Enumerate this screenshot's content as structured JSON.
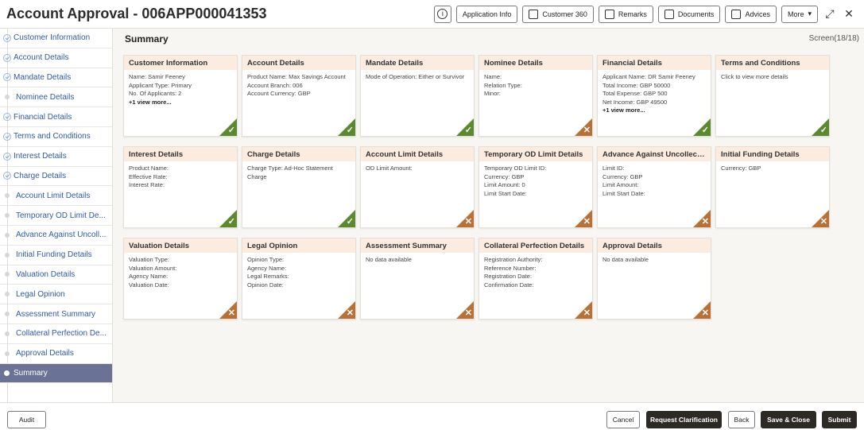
{
  "header": {
    "title": "Account Approval - 006APP000041353",
    "buttons": {
      "info": "i",
      "application_info": "Application Info",
      "customer_360": "Customer 360",
      "remarks": "Remarks",
      "documents": "Documents",
      "advices": "Advices",
      "more": "More"
    }
  },
  "sidebar": {
    "items": [
      {
        "label": "Customer Information",
        "state": "done"
      },
      {
        "label": "Account Details",
        "state": "done"
      },
      {
        "label": "Mandate Details",
        "state": "done"
      },
      {
        "label": "Nominee Details",
        "state": "pending"
      },
      {
        "label": "Financial Details",
        "state": "done"
      },
      {
        "label": "Terms and Conditions",
        "state": "done"
      },
      {
        "label": "Interest Details",
        "state": "done"
      },
      {
        "label": "Charge Details",
        "state": "done"
      },
      {
        "label": "Account Limit Details",
        "state": "pending"
      },
      {
        "label": "Temporary OD Limit De...",
        "state": "pending"
      },
      {
        "label": "Advance Against Uncoll...",
        "state": "pending"
      },
      {
        "label": "Initial Funding Details",
        "state": "pending"
      },
      {
        "label": "Valuation Details",
        "state": "pending"
      },
      {
        "label": "Legal Opinion",
        "state": "pending"
      },
      {
        "label": "Assessment Summary",
        "state": "pending"
      },
      {
        "label": "Collateral Perfection De...",
        "state": "pending"
      },
      {
        "label": "Approval Details",
        "state": "pending"
      },
      {
        "label": "Summary",
        "state": "active"
      }
    ]
  },
  "main": {
    "title": "Summary",
    "screen_label": "Screen(18/18)",
    "cards": [
      {
        "title": "Customer Information",
        "lines": [
          "Name: Samir Feeney",
          "Applicant Type: Primary",
          "No. Of Applicants: 2"
        ],
        "more": "+1 view more...",
        "status": "ok"
      },
      {
        "title": "Account Details",
        "lines": [
          "Product Name: Max Savings Account",
          "Account Branch: 006",
          "Account Currency: GBP"
        ],
        "more": "",
        "status": "ok"
      },
      {
        "title": "Mandate Details",
        "lines": [
          "Mode of Operation: Either or Survivor"
        ],
        "more": "",
        "status": "ok"
      },
      {
        "title": "Nominee Details",
        "lines": [
          "Name:",
          "Relation Type:",
          "Minor:"
        ],
        "more": "",
        "status": "no"
      },
      {
        "title": "Financial Details",
        "lines": [
          "Applicant Name: DR Samir Feeney",
          "Total Income: GBP 50000",
          "Total Expense: GBP 500",
          "Net Income: GBP 49500"
        ],
        "more": "+1 view more...",
        "status": "ok"
      },
      {
        "title": "Terms and Conditions",
        "lines": [
          "Click to view more details"
        ],
        "more": "",
        "status": "ok"
      },
      {
        "title": "Interest Details",
        "lines": [
          "Product Name:",
          "Effective Rate:",
          "Interest Rate:"
        ],
        "more": "",
        "status": "ok"
      },
      {
        "title": "Charge Details",
        "lines": [
          "Charge Type: Ad-Hoc Statement Charge"
        ],
        "more": "",
        "status": "ok"
      },
      {
        "title": "Account Limit Details",
        "lines": [
          "OD Limit Amount:"
        ],
        "more": "",
        "status": "no"
      },
      {
        "title": "Temporary OD Limit Details",
        "lines": [
          "Temporary OD Limit ID:",
          "Currency: GBP",
          "Limit Amount: 0",
          "Limit Start Date:"
        ],
        "more": "",
        "status": "no"
      },
      {
        "title": "Advance Against Uncollecte...",
        "lines": [
          "Limit ID:",
          "Currency: GBP",
          "Limit Amount:",
          "Limit Start Date:"
        ],
        "more": "",
        "status": "no"
      },
      {
        "title": "Initial Funding Details",
        "lines": [
          "Currency: GBP"
        ],
        "more": "",
        "status": "no"
      },
      {
        "title": "Valuation Details",
        "lines": [
          "Valuation Type:",
          "Valuation Amount:",
          "Agency Name:",
          "Valuation Date:"
        ],
        "more": "",
        "status": "no"
      },
      {
        "title": "Legal Opinion",
        "lines": [
          "Opinion Type:",
          "Agency Name:",
          "Legal Remarks:",
          "Opinion Date:"
        ],
        "more": "",
        "status": "no"
      },
      {
        "title": "Assessment Summary",
        "lines": [
          "No data available"
        ],
        "more": "",
        "status": "no"
      },
      {
        "title": "Collateral Perfection Details",
        "lines": [
          "Registration Authority:",
          "Reference Number:",
          "Registration Date:",
          "Confirmation Date:"
        ],
        "more": "",
        "status": "no"
      },
      {
        "title": "Approval Details",
        "lines": [
          "No data available"
        ],
        "more": "",
        "status": "no"
      }
    ]
  },
  "footer": {
    "audit": "Audit",
    "cancel": "Cancel",
    "request_clarification": "Request Clarification",
    "back": "Back",
    "save_close": "Save & Close",
    "submit": "Submit"
  }
}
